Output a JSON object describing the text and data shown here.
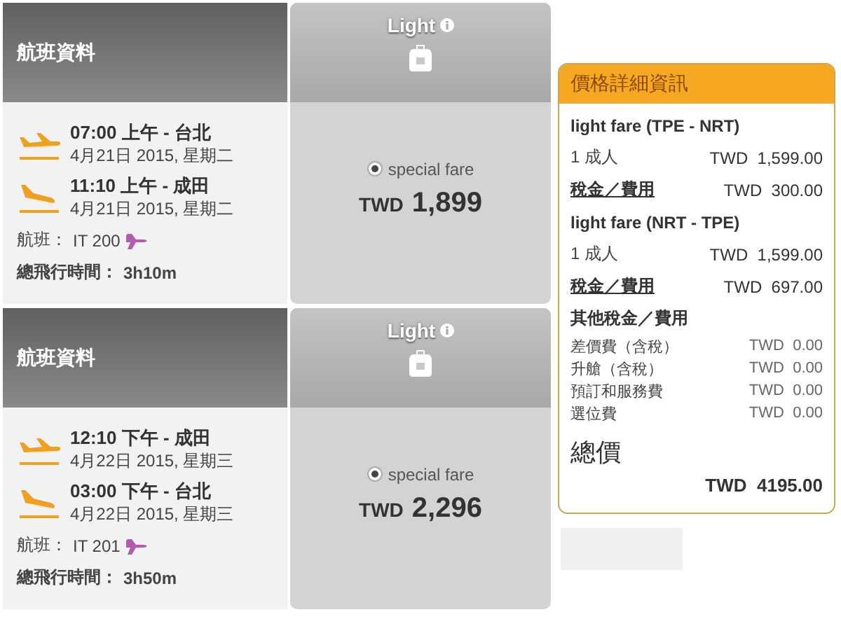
{
  "flights": [
    {
      "header": "航班資料",
      "segments": [
        {
          "kind": "departure",
          "time": "07:00",
          "period": "上午",
          "city": "- 台北",
          "date": "4月21日 2015, 星期二"
        },
        {
          "kind": "arrival",
          "time": "11:10",
          "period": "上午",
          "city": "- 成田",
          "date": "4月21日 2015, 星期二"
        }
      ],
      "flight_label": "航班：",
      "flight_number": "IT 200",
      "duration_label": "總飛行時間：",
      "duration": "3h10m",
      "fare": {
        "name": "Light",
        "option": "special fare",
        "selected": true,
        "currency": "TWD",
        "price": "1,899"
      }
    },
    {
      "header": "航班資料",
      "segments": [
        {
          "kind": "departure",
          "time": "12:10",
          "period": "下午",
          "city": "- 成田",
          "date": "4月22日 2015, 星期三"
        },
        {
          "kind": "arrival",
          "time": "03:00",
          "period": "下午",
          "city": "- 台北",
          "date": "4月22日 2015, 星期三"
        }
      ],
      "flight_label": "航班：",
      "flight_number": "IT 201",
      "duration_label": "總飛行時間：",
      "duration": "3h50m",
      "fare": {
        "name": "Light",
        "option": "special fare",
        "selected": true,
        "currency": "TWD",
        "price": "2,296"
      }
    }
  ],
  "price_panel": {
    "title": "價格詳細資訊",
    "rows": [
      {
        "kind": "heading",
        "label": "light fare (TPE - NRT)"
      },
      {
        "kind": "line",
        "label": "1 成人",
        "value": "TWD  1,599.00"
      },
      {
        "kind": "link",
        "label": "稅金／費用",
        "value": "TWD  300.00"
      },
      {
        "kind": "heading",
        "label": "light fare (NRT - TPE)"
      },
      {
        "kind": "line",
        "label": "1 成人",
        "value": "TWD  1,599.00"
      },
      {
        "kind": "link",
        "label": "稅金／費用",
        "value": "TWD  697.00"
      },
      {
        "kind": "heading",
        "label": "其他稅金／費用"
      },
      {
        "kind": "small",
        "label": "差價費（含稅）",
        "value": "TWD  0.00"
      },
      {
        "kind": "small",
        "label": "升艙（含稅）",
        "value": "TWD  0.00"
      },
      {
        "kind": "small",
        "label": "預訂和服務費",
        "value": "TWD  0.00"
      },
      {
        "kind": "small",
        "label": "選位費",
        "value": "TWD  0.00"
      }
    ],
    "total_label": "總價",
    "total": "TWD  4195.00"
  }
}
